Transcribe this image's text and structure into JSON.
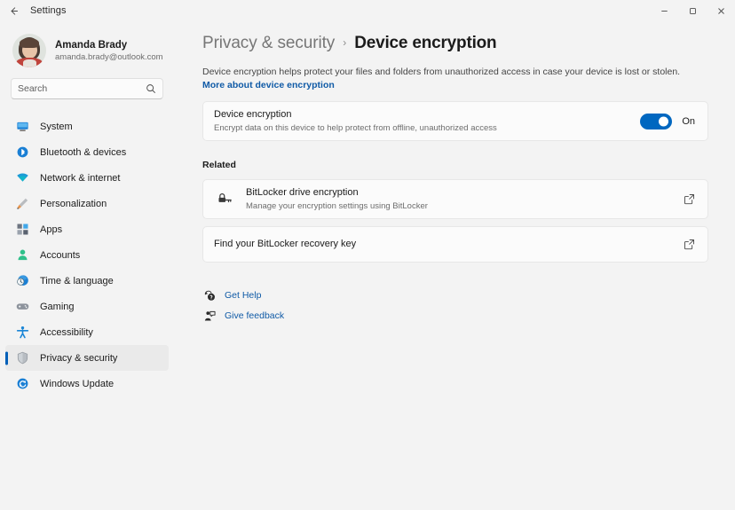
{
  "window": {
    "title": "Settings",
    "back_icon": "back-arrow-icon",
    "controls": {
      "minimize": "minimize-icon",
      "maximize": "maximize-icon",
      "close": "close-icon"
    }
  },
  "sidebar": {
    "account": {
      "name": "Amanda Brady",
      "email": "amanda.brady@outlook.com",
      "avatar": "user-avatar"
    },
    "search": {
      "placeholder": "Search",
      "icon": "search-icon"
    },
    "items": [
      {
        "label": "System",
        "icon": "monitor-icon",
        "selected": false
      },
      {
        "label": "Bluetooth & devices",
        "icon": "bluetooth-icon",
        "selected": false
      },
      {
        "label": "Network & internet",
        "icon": "wifi-icon",
        "selected": false
      },
      {
        "label": "Personalization",
        "icon": "paintbrush-icon",
        "selected": false
      },
      {
        "label": "Apps",
        "icon": "apps-grid-icon",
        "selected": false
      },
      {
        "label": "Accounts",
        "icon": "person-icon",
        "selected": false
      },
      {
        "label": "Time & language",
        "icon": "clock-globe-icon",
        "selected": false
      },
      {
        "label": "Gaming",
        "icon": "gamepad-icon",
        "selected": false
      },
      {
        "label": "Accessibility",
        "icon": "accessibility-person-icon",
        "selected": false
      },
      {
        "label": "Privacy & security",
        "icon": "shield-icon",
        "selected": true
      },
      {
        "label": "Windows Update",
        "icon": "refresh-icon",
        "selected": false
      }
    ]
  },
  "main": {
    "breadcrumb": {
      "parent": "Privacy & security",
      "separator": "›",
      "current": "Device encryption"
    },
    "description": {
      "text": "Device encryption helps protect your files and folders from unauthorized access in case your device is lost or stolen. ",
      "link": "More about device encryption"
    },
    "device_encryption": {
      "title": "Device encryption",
      "subtitle": "Encrypt data on this device to help protect from offline, unauthorized access",
      "toggle_state": "On",
      "toggle_on": true,
      "accent_color": "#0067c0"
    },
    "related": {
      "heading": "Related",
      "items": [
        {
          "title": "BitLocker drive encryption",
          "subtitle": "Manage your encryption settings using BitLocker",
          "lead_icon": "bitlocker-lock-key-icon",
          "action_icon": "external-link-icon"
        },
        {
          "title": "Find your BitLocker recovery key",
          "subtitle": "",
          "lead_icon": "",
          "action_icon": "external-link-icon"
        }
      ]
    },
    "help_links": [
      {
        "label": "Get Help",
        "icon": "get-help-icon"
      },
      {
        "label": "Give feedback",
        "icon": "give-feedback-icon"
      }
    ]
  }
}
